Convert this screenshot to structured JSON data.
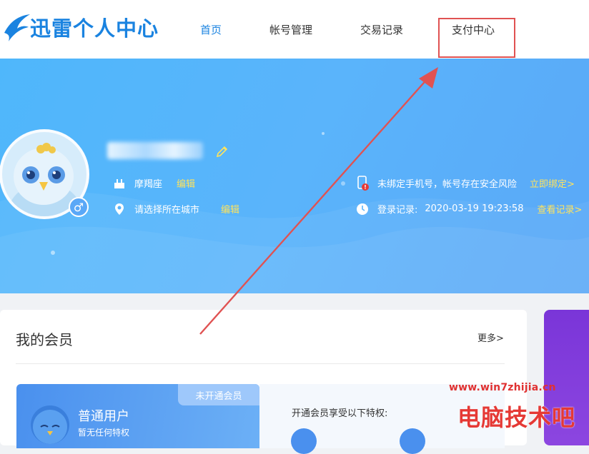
{
  "app": {
    "logo_text": "迅雷个人中心"
  },
  "nav": {
    "items": [
      {
        "label": "首页",
        "active": true
      },
      {
        "label": "帐号管理",
        "active": false
      },
      {
        "label": "交易记录",
        "active": false
      },
      {
        "label": "支付中心",
        "active": false
      }
    ],
    "highlight_color": "#e05252"
  },
  "profile": {
    "username": "",
    "gender_icon": "male-icon",
    "zodiac": "摩羯座",
    "zodiac_edit": "编辑",
    "city": "请选择所在城市",
    "city_edit": "编辑",
    "phone_warning": "未绑定手机号，帐号存在安全风险",
    "phone_bind": "立即绑定>",
    "login_label": "登录记录:",
    "login_time": "2020-03-19 19:23:58",
    "login_view": "查看记录>"
  },
  "member": {
    "title": "我的会员",
    "more": "更多>",
    "status_tag": "未开通会员",
    "user_type": "普通用户",
    "privileges": "暂无任何特权",
    "open_prompt": "开通会员享受以下特权:"
  },
  "watermark": {
    "url": "www.win7zhijia.cn",
    "text": "电脑技术吧"
  },
  "colors": {
    "accent": "#1a83e0",
    "banner": "#5ab4fb",
    "link_yellow": "#ffe35c",
    "annotation_red": "#e05252"
  }
}
